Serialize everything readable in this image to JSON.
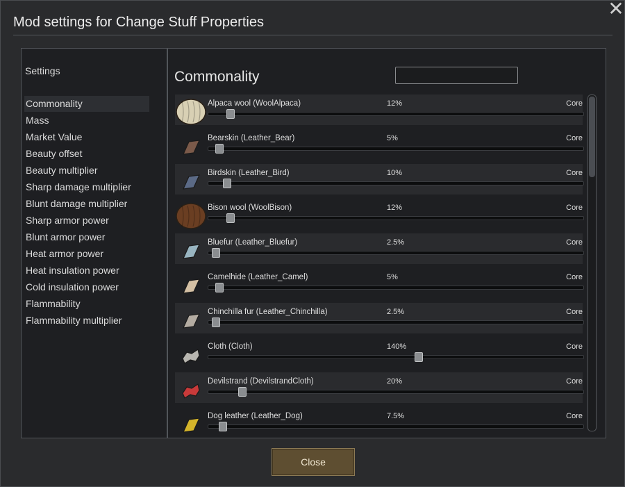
{
  "window": {
    "title": "Mod settings for Change Stuff Properties",
    "close_symbol": "✕"
  },
  "sidebar": {
    "heading": "Settings",
    "selected_index": 0,
    "items": [
      {
        "label": "Commonality"
      },
      {
        "label": "Mass"
      },
      {
        "label": "Market Value"
      },
      {
        "label": "Beauty offset"
      },
      {
        "label": "Beauty multiplier"
      },
      {
        "label": "Sharp damage multiplier"
      },
      {
        "label": "Blunt damage multiplier"
      },
      {
        "label": "Sharp armor power"
      },
      {
        "label": "Blunt armor power"
      },
      {
        "label": "Heat armor power"
      },
      {
        "label": "Heat insulation power"
      },
      {
        "label": "Cold insulation power"
      },
      {
        "label": "Flammability"
      },
      {
        "label": "Flammability multiplier"
      }
    ]
  },
  "main": {
    "title": "Commonality",
    "search": {
      "value": "",
      "placeholder": ""
    },
    "scroll_position": 0.0,
    "rows": [
      {
        "label": "Alpaca wool (WoolAlpaca)",
        "value_text": "12%",
        "source": "Core",
        "level": 0.057,
        "icon": "wool-icon",
        "color": "#d8d0b4"
      },
      {
        "label": "Bearskin (Leather_Bear)",
        "value_text": "5%",
        "source": "Core",
        "level": 0.028,
        "icon": "leather-icon",
        "color": "#7b5a4a"
      },
      {
        "label": "Birdskin (Leather_Bird)",
        "value_text": "10%",
        "source": "Core",
        "level": 0.048,
        "icon": "leather-icon",
        "color": "#5b6a86"
      },
      {
        "label": "Bison wool (WoolBison)",
        "value_text": "12%",
        "source": "Core",
        "level": 0.057,
        "icon": "wool-icon",
        "color": "#6a3e22"
      },
      {
        "label": "Bluefur (Leather_Bluefur)",
        "value_text": "2.5%",
        "source": "Core",
        "level": 0.019,
        "icon": "leather-icon",
        "color": "#98b4c0"
      },
      {
        "label": "Camelhide (Leather_Camel)",
        "value_text": "5%",
        "source": "Core",
        "level": 0.028,
        "icon": "leather-icon",
        "color": "#d4c0a4"
      },
      {
        "label": "Chinchilla fur (Leather_Chinchilla)",
        "value_text": "2.5%",
        "source": "Core",
        "level": 0.019,
        "icon": "leather-icon",
        "color": "#b4aca2"
      },
      {
        "label": "Cloth (Cloth)",
        "value_text": "140%",
        "source": "Core",
        "level": 0.559,
        "icon": "cloth-icon",
        "color": "#b8b6b0"
      },
      {
        "label": "Devilstrand (DevilstrandCloth)",
        "value_text": "20%",
        "source": "Core",
        "level": 0.089,
        "icon": "cloth-icon",
        "color": "#c83a3a"
      },
      {
        "label": "Dog leather (Leather_Dog)",
        "value_text": "7.5%",
        "source": "Core",
        "level": 0.037,
        "icon": "leather-icon",
        "color": "#d4b42a"
      }
    ]
  },
  "footer": {
    "close_label": "Close"
  }
}
